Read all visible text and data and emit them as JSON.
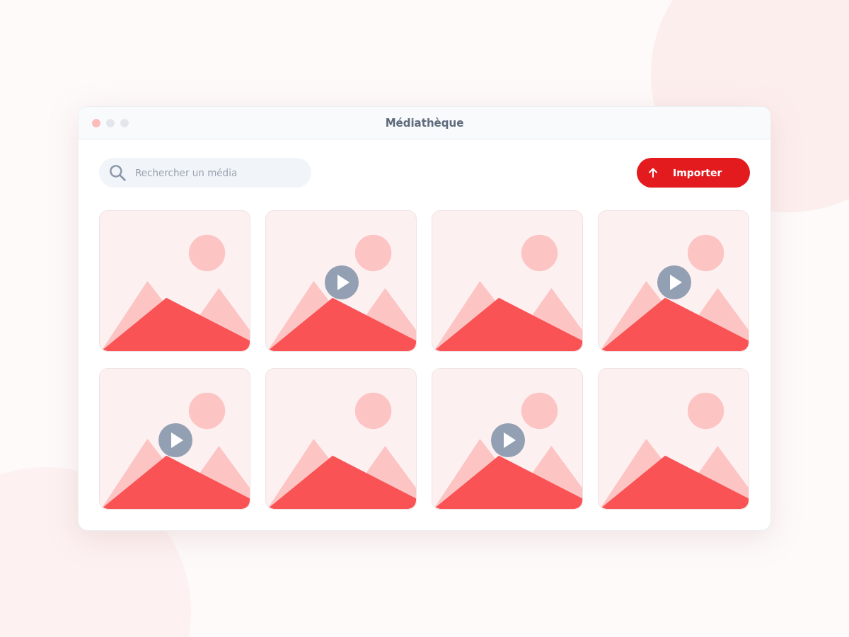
{
  "window": {
    "title": "Médiathèque"
  },
  "search": {
    "placeholder": "Rechercher un média"
  },
  "import_button": {
    "label": "Importer"
  },
  "media": [
    {
      "kind": "image"
    },
    {
      "kind": "video"
    },
    {
      "kind": "image"
    },
    {
      "kind": "video"
    },
    {
      "kind": "video"
    },
    {
      "kind": "image"
    },
    {
      "kind": "video"
    },
    {
      "kind": "image"
    }
  ]
}
